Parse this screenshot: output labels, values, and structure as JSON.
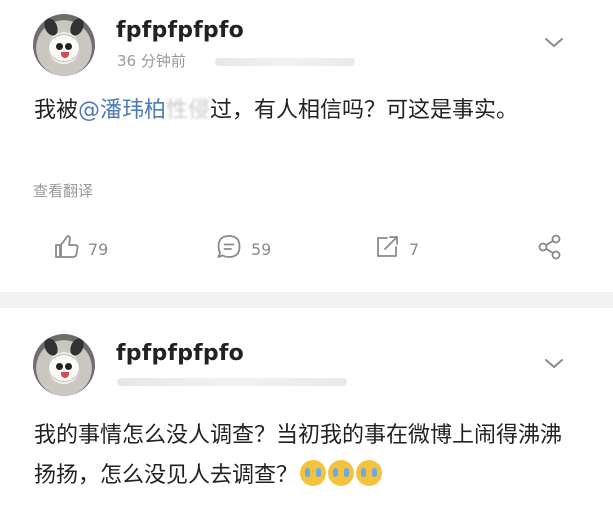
{
  "post1": {
    "username": "fpfpfpfpfo",
    "time": "36 分钟前",
    "text_before": "我被",
    "mention": "@潘玮柏",
    "blurred_word": "性侵",
    "text_after": "过，有人相信吗？可这是事实。",
    "translate_label": "查看翻译",
    "actions": {
      "like_count": "79",
      "comment_count": "59",
      "repost_count": "7"
    }
  },
  "post2": {
    "username": "fpfpfpfpfo",
    "text": "我的事情怎么没人调查？当初我的事在微博上闹得沸沸扬扬，怎么没见人去调查？"
  },
  "icons": {
    "like": "thumbs-up-icon",
    "comment": "comment-icon",
    "repost": "repost-icon",
    "share": "share-icon",
    "more": "chevron-down-icon",
    "emoji": "crying-face-emoji"
  }
}
